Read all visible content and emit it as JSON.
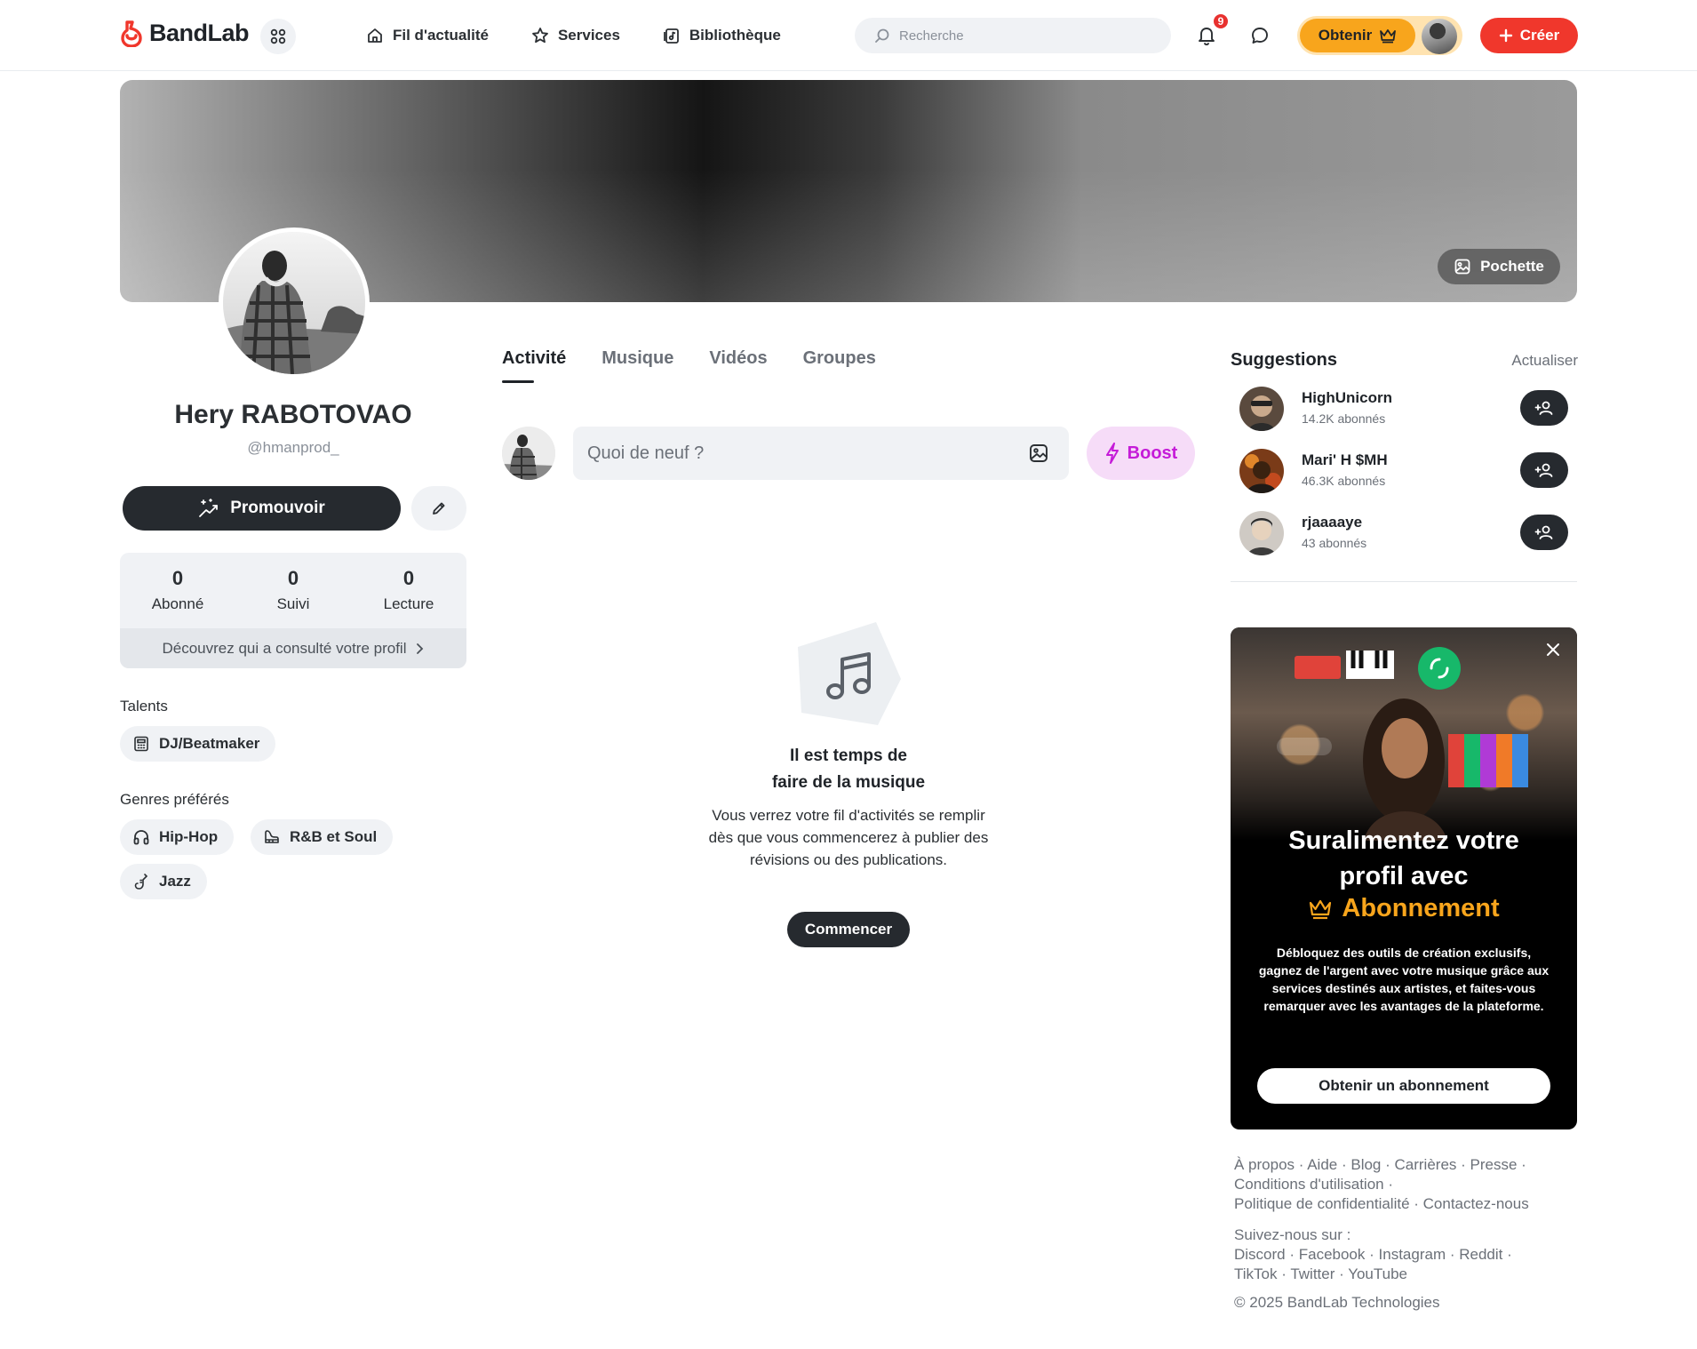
{
  "app": {
    "brand": "BandLab",
    "accent_color": "#f0372c"
  },
  "topbar": {
    "nav": [
      {
        "label": "Fil d'actualité",
        "icon": "home-icon"
      },
      {
        "label": "Services",
        "icon": "star-icon"
      },
      {
        "label": "Bibliothèque",
        "icon": "library-icon"
      }
    ],
    "search_placeholder": "Recherche",
    "notifications_count": "9",
    "obtenir_label": "Obtenir",
    "creer_label": "Créer"
  },
  "cover": {
    "pochette_label": "Pochette"
  },
  "profile": {
    "name": "Hery RABOTOVAO",
    "handle": "@hmanprod_",
    "promote_label": "Promouvoir",
    "stats": [
      {
        "value": "0",
        "label": "Abonné"
      },
      {
        "value": "0",
        "label": "Suivi"
      },
      {
        "value": "0",
        "label": "Lecture"
      }
    ],
    "views_link": "Découvrez qui a consulté votre profil",
    "talents_title": "Talents",
    "talents": [
      {
        "label": "DJ/Beatmaker",
        "icon": "calculator-icon"
      }
    ],
    "genres_title": "Genres préférés",
    "genres": [
      {
        "label": "Hip-Hop",
        "icon": "headphones-icon"
      },
      {
        "label": "R&B et Soul",
        "icon": "piano-icon"
      },
      {
        "label": "Jazz",
        "icon": "saxophone-icon"
      }
    ]
  },
  "tabs": [
    "Activité",
    "Musique",
    "Vidéos",
    "Groupes"
  ],
  "composer": {
    "placeholder": "Quoi de neuf ?",
    "boost_label": "Boost"
  },
  "empty_state": {
    "title_line1": "Il est temps de",
    "title_line2": "faire de la musique",
    "text": "Vous verrez votre fil d'activités se remplir dès que vous commencerez à publier des révisions ou des publications.",
    "button": "Commencer"
  },
  "suggestions": {
    "title": "Suggestions",
    "refresh_label": "Actualiser",
    "items": [
      {
        "name": "HighUnicorn",
        "followers": "14.2K abonnés"
      },
      {
        "name": "Mari' H $MH",
        "followers": "46.3K abonnés"
      },
      {
        "name": "rjaaaaye",
        "followers": "43 abonnés"
      }
    ]
  },
  "promo": {
    "heading_line1": "Suralimentez votre",
    "heading_line2": "profil avec",
    "heading_accent": "Abonnement",
    "description": "Débloquez des outils de création exclusifs, gagnez de l'argent avec votre musique grâce aux services destinés aux artistes, et faites-vous remarquer avec les avantages de la plateforme.",
    "cta": "Obtenir un abonnement",
    "accent_color": "#f8a51c"
  },
  "footer": {
    "links": [
      "À propos",
      "Aide",
      "Blog",
      "Carrières",
      "Presse",
      "Conditions d'utilisation",
      "Politique de confidentialité",
      "Contactez-nous"
    ],
    "follow_title": "Suivez-nous sur :",
    "social": [
      "Discord",
      "Facebook",
      "Instagram",
      "Reddit",
      "TikTok",
      "Twitter",
      "YouTube"
    ],
    "copyright": "© 2025 BandLab Technologies"
  }
}
